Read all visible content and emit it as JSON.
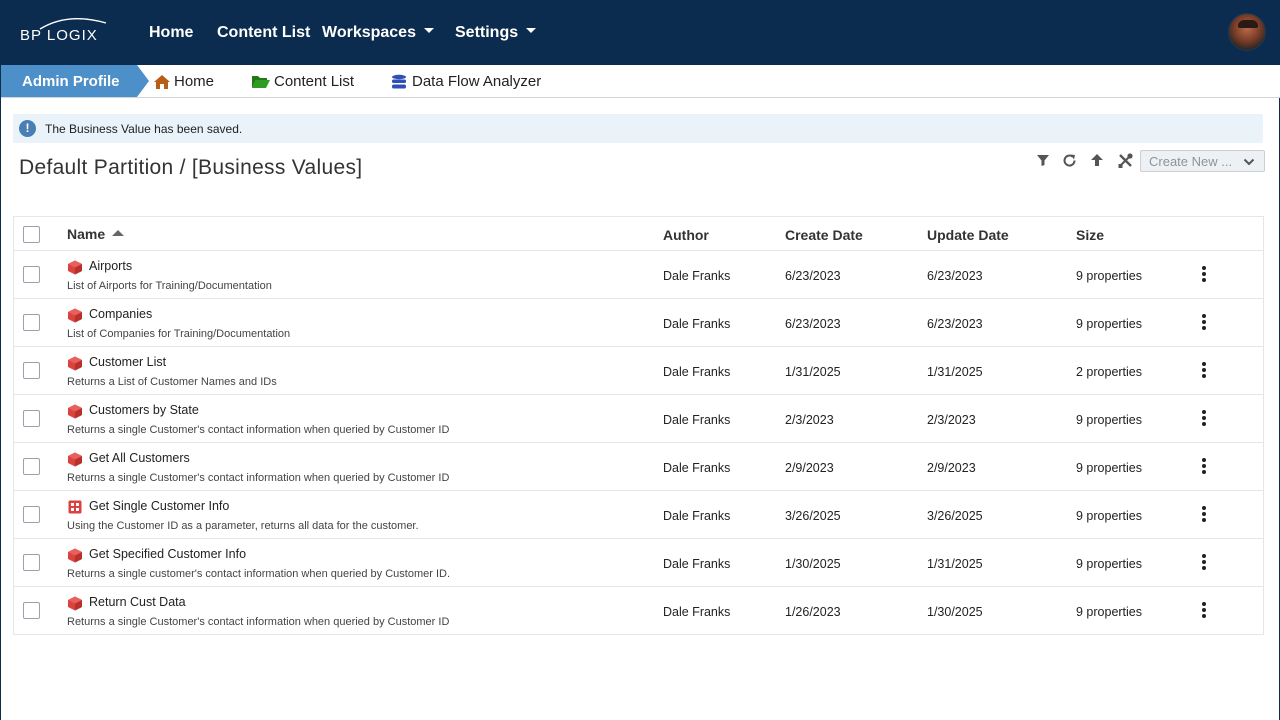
{
  "topnav": {
    "logo_text": "BP LOGIX",
    "items": [
      {
        "label": "Home"
      },
      {
        "label": "Content List"
      },
      {
        "label": "Workspaces"
      },
      {
        "label": "Settings"
      }
    ]
  },
  "breadcrumb": {
    "profile": "Admin Profile",
    "links": [
      {
        "label": "Home",
        "icon": "home-icon",
        "color": "#b85c17"
      },
      {
        "label": "Content List",
        "icon": "folder-open-icon",
        "color": "#2e8b1e"
      },
      {
        "label": "Data Flow Analyzer",
        "icon": "database-icon",
        "color": "#2f4fb5"
      }
    ]
  },
  "alert": {
    "icon": "info-icon",
    "text": "The Business Value has been saved."
  },
  "page": {
    "title": "Default Partition / [Business Values]"
  },
  "toolbar": {
    "icons": [
      "filter-icon",
      "refresh-icon",
      "up-arrow-icon",
      "tools-icon"
    ],
    "create_new_label": "Create New ..."
  },
  "table": {
    "headers": {
      "name": "Name",
      "author": "Author",
      "create_date": "Create Date",
      "update_date": "Update Date",
      "size": "Size"
    },
    "rows": [
      {
        "name": "Airports",
        "description": "List of Airports for Training/Documentation",
        "author": "Dale Franks",
        "create_date": "6/23/2023",
        "update_date": "6/23/2023",
        "size": "9 properties",
        "icon": "cube-icon"
      },
      {
        "name": "Companies",
        "description": "List of Companies for Training/Documentation",
        "author": "Dale Franks",
        "create_date": "6/23/2023",
        "update_date": "6/23/2023",
        "size": "9 properties",
        "icon": "cube-icon"
      },
      {
        "name": "Customer List",
        "description": "Returns a List of Customer Names and IDs",
        "author": "Dale Franks",
        "create_date": "1/31/2025",
        "update_date": "1/31/2025",
        "size": "2 properties",
        "icon": "cube-icon"
      },
      {
        "name": "Customers by State",
        "description": "Returns a single Customer's contact information when queried by Customer ID",
        "author": "Dale Franks",
        "create_date": "2/3/2023",
        "update_date": "2/3/2023",
        "size": "9 properties",
        "icon": "cube-icon"
      },
      {
        "name": "Get All Customers",
        "description": "Returns a single Customer's contact information when queried by Customer ID",
        "author": "Dale Franks",
        "create_date": "2/9/2023",
        "update_date": "2/9/2023",
        "size": "9 properties",
        "icon": "cube-icon"
      },
      {
        "name": "Get Single Customer Info",
        "description": "Using the Customer ID as a parameter, returns all data for the customer.",
        "author": "Dale Franks",
        "create_date": "3/26/2025",
        "update_date": "3/26/2025",
        "size": "9 properties",
        "icon": "grid-icon"
      },
      {
        "name": "Get Specified Customer Info",
        "description": "Returns a single customer's contact information when queried by Customer ID.",
        "author": "Dale Franks",
        "create_date": "1/30/2025",
        "update_date": "1/31/2025",
        "size": "9 properties",
        "icon": "cube-icon"
      },
      {
        "name": "Return Cust Data",
        "description": "Returns a single Customer's contact information when queried by Customer ID",
        "author": "Dale Franks",
        "create_date": "1/26/2023",
        "update_date": "1/30/2025",
        "size": "9 properties",
        "icon": "cube-icon"
      }
    ]
  },
  "colors": {
    "nav_bg": "#0b2c4f",
    "profile_tab": "#4d8fc9",
    "item_icon": "#d9423f"
  }
}
